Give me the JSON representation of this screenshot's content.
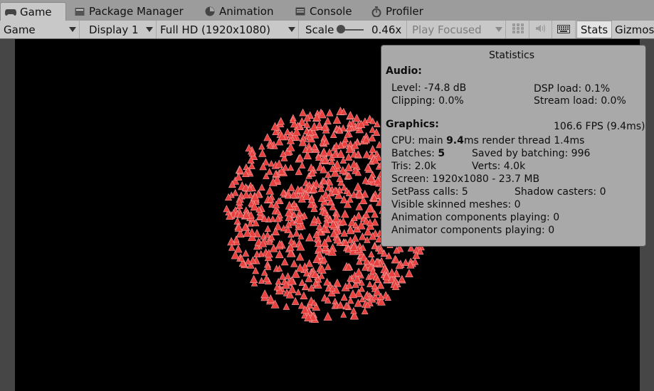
{
  "tabs": [
    {
      "label": "Game",
      "icon": "gamepad-icon",
      "active": true
    },
    {
      "label": "Package Manager",
      "icon": "package-icon",
      "active": false
    },
    {
      "label": "Animation",
      "icon": "animation-icon",
      "active": false
    },
    {
      "label": "Console",
      "icon": "console-icon",
      "active": false
    },
    {
      "label": "Profiler",
      "icon": "stopwatch-icon",
      "active": false
    }
  ],
  "toolbar": {
    "view": "Game",
    "display": "Display 1",
    "resolution": "Full HD (1920x1080)",
    "scale_label": "Scale",
    "scale_value": "0.46x",
    "scale_fraction": 0.1,
    "play_mode": "Play Focused",
    "stats_label": "Stats",
    "gizmos_label": "Gizmos"
  },
  "stats": {
    "title": "Statistics",
    "audio_header": "Audio:",
    "level": "Level: -74.8 dB",
    "clipping": "Clipping: 0.0%",
    "dsp_load": "DSP load: 0.1%",
    "stream_load": "Stream load: 0.0%",
    "graphics_header": "Graphics:",
    "fps": "106.6 FPS (9.4ms)",
    "cpu_prefix": "CPU: main ",
    "cpu_main": "9.4",
    "cpu_suffix": "ms  render thread 1.4ms",
    "batches_prefix": "Batches: ",
    "batches": "5",
    "saved_by_batching": "Saved by batching: 996",
    "tris": "Tris: 2.0k",
    "verts": "Verts: 4.0k",
    "screen": "Screen: 1920x1080 - 23.7 MB",
    "setpass": "SetPass calls: 5",
    "shadow_casters": "Shadow casters: 0",
    "skinned_meshes": "Visible skinned meshes: 0",
    "animation_components": "Animation components playing: 0",
    "animator_components": "Animator components playing: 0"
  },
  "colors": {
    "particle": "#e8413f",
    "viewport_bg": "#000000",
    "panel_bg": "#a9a9a9"
  }
}
